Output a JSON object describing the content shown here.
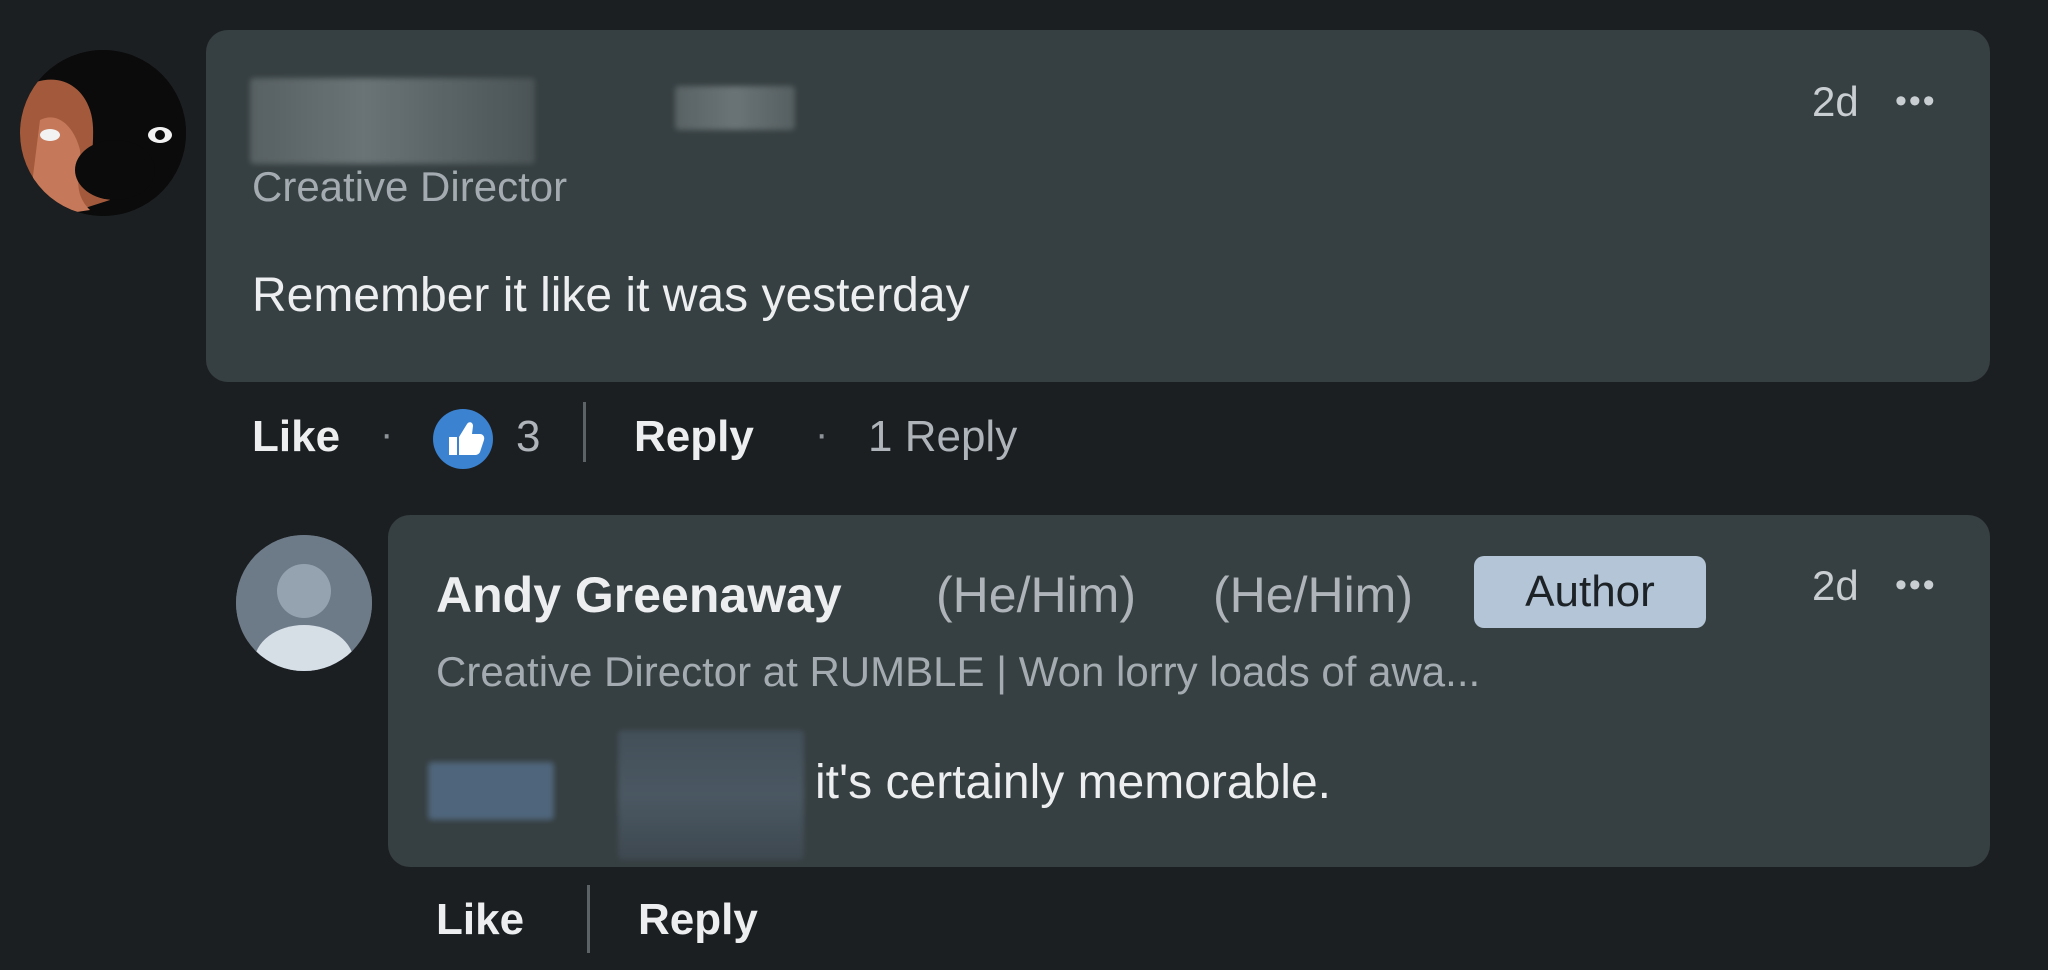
{
  "comment": {
    "headline": "Creative Director",
    "timestamp": "2d",
    "more_icon": "•••",
    "text": "Remember it like it was yesterday",
    "actions": {
      "like_label": "Like",
      "separator": "·",
      "reaction_icon": "thumbs-up-icon",
      "reaction_count": "3",
      "reply_label": "Reply",
      "replies_label": "1 Reply"
    }
  },
  "reply": {
    "author_name": "Andy Greenaway",
    "pronoun_1": "(He/Him)",
    "pronoun_2": "(He/Him)",
    "badge": "Author",
    "headline": "Creative Director at RUMBLE | Won lorry loads of awa...",
    "timestamp": "2d",
    "more_icon": "•••",
    "text": "it's certainly memorable.",
    "actions": {
      "like_label": "Like",
      "reply_label": "Reply"
    }
  },
  "colors": {
    "page_background": "#1c1f22",
    "bubble_background": "#363f41",
    "reaction_blue": "#3b82d0",
    "badge_background": "#b3c5d6"
  }
}
